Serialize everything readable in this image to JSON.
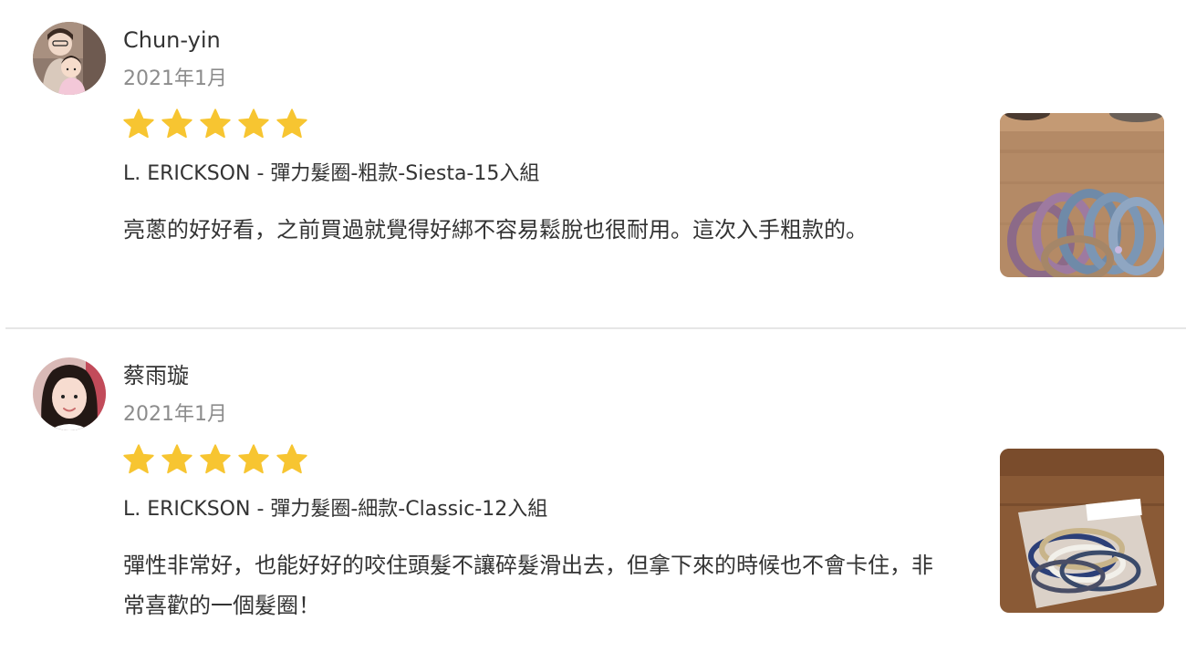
{
  "reviews": [
    {
      "reviewer": "Chun-yin",
      "date": "2021年1月",
      "rating": 5,
      "product": "L. ERICKSON - 彈力髮圈-粗款-Siesta-15入組",
      "text": "亮蔥的好好看，之前買過就覺得好綁不容易鬆脫也很耐用。這次入手粗款的。"
    },
    {
      "reviewer": "蔡雨璇",
      "date": "2021年1月",
      "rating": 5,
      "product": "L. ERICKSON - 彈力髮圈-細款-Classic-12入組",
      "text": "彈性非常好，也能好好的咬住頭髮不讓碎髮滑出去，但拿下來的時候也不會卡住，非常喜歡的一個髮圈！"
    }
  ],
  "colors": {
    "star": "#f7c531",
    "date": "#8c8c8c",
    "text": "#333333",
    "divider": "#e6e6e6"
  }
}
